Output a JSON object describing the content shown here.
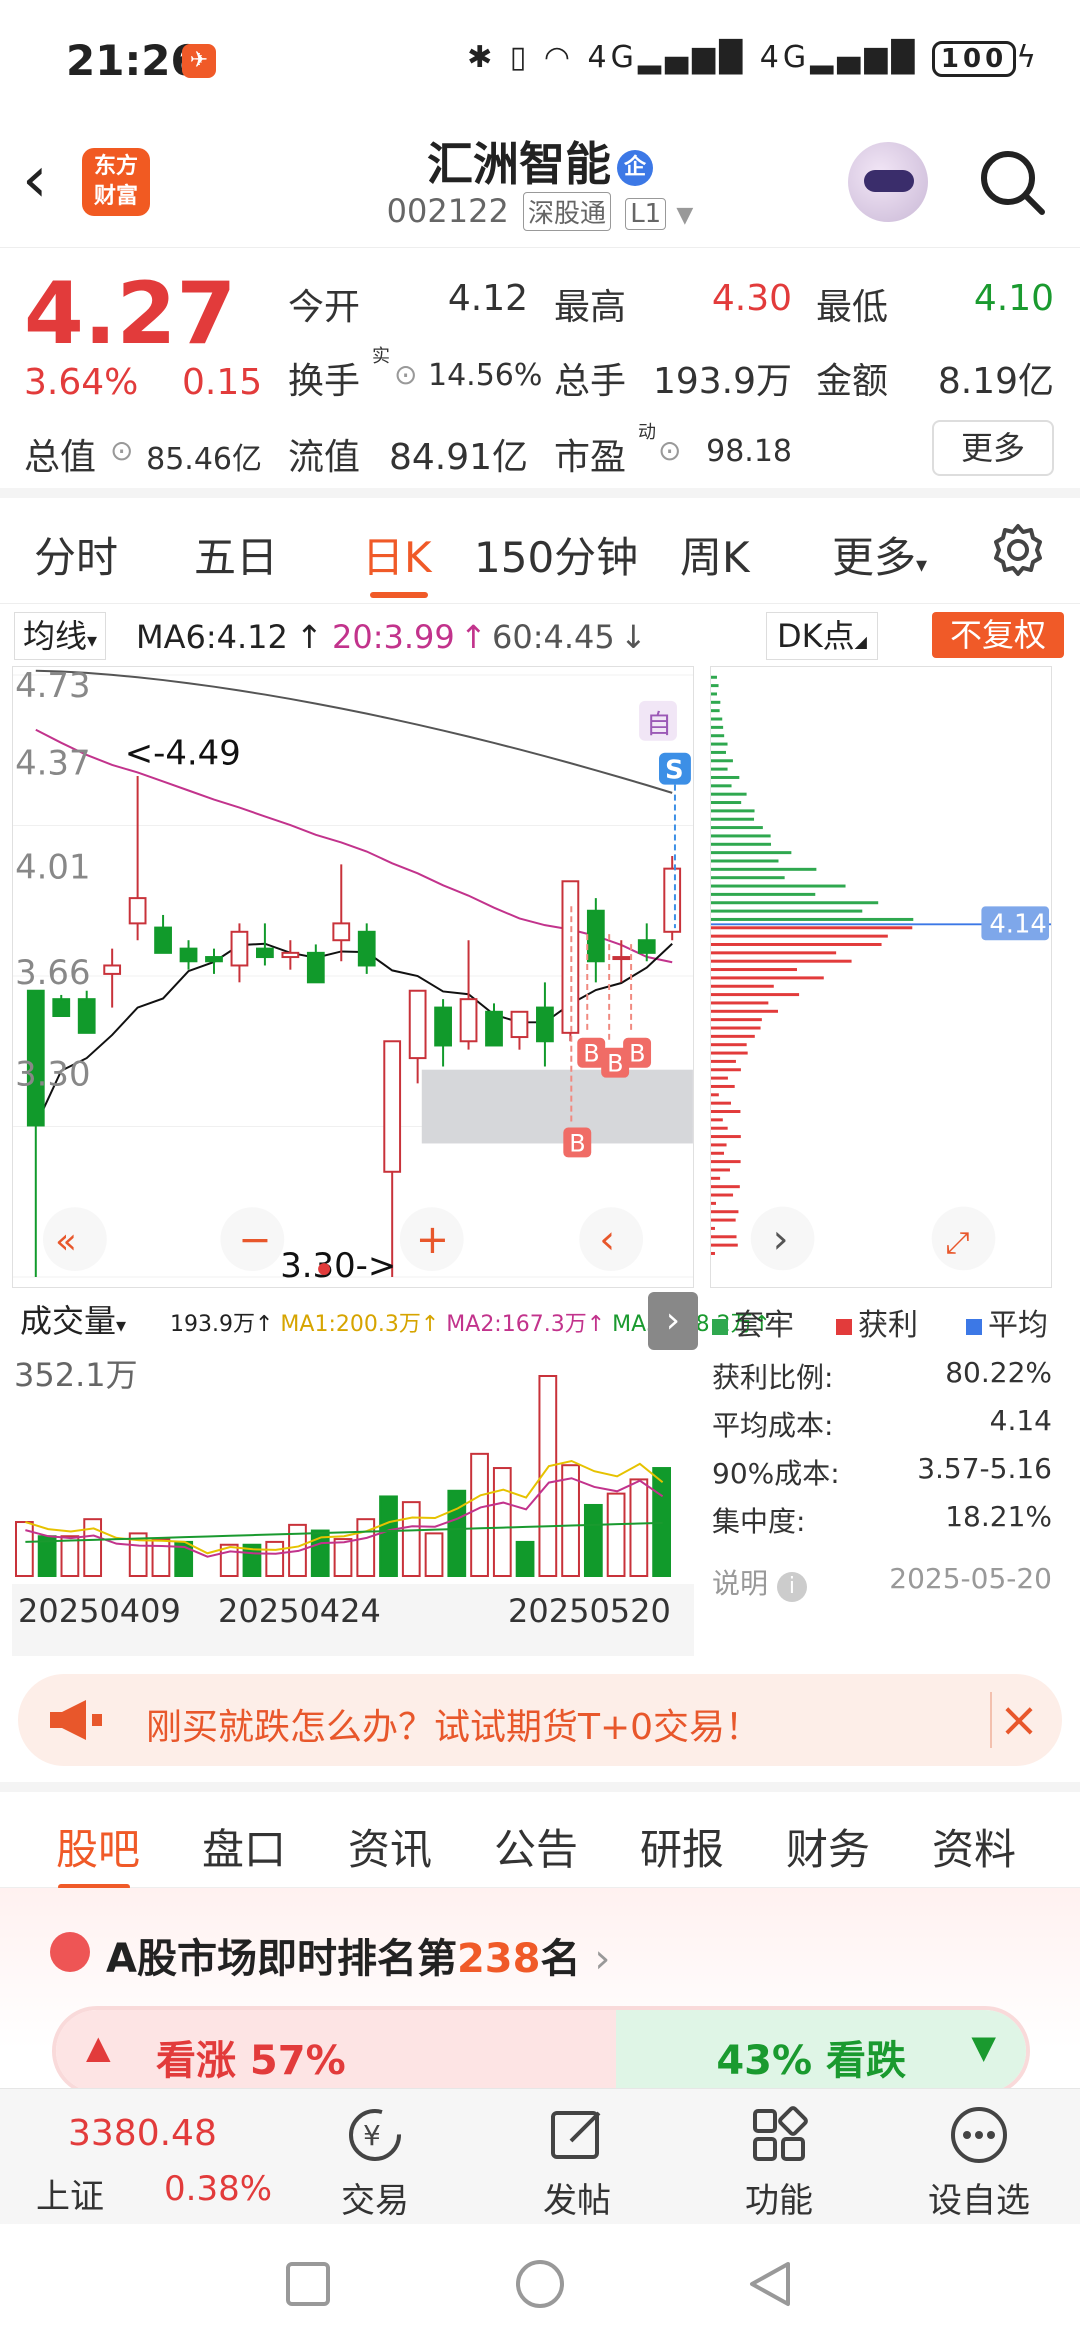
{
  "status_bar": {
    "time": "21:26",
    "network": "4G",
    "battery": "100"
  },
  "header": {
    "logo_line1": "东方",
    "logo_line2": "财富",
    "stock_name": "汇洲智能",
    "name_badge": "企",
    "stock_code": "002122",
    "tag_hk": "深股通",
    "tag_level": "L1"
  },
  "quote": {
    "price": "4.27",
    "change_pct": "3.64%",
    "change_amt": "0.15",
    "open_label": "今开",
    "open": "4.12",
    "high_label": "最高",
    "high": "4.30",
    "low_label": "最低",
    "low": "4.10",
    "turnover_label": "换手",
    "turnover_sup": "实",
    "turnover": "14.56%",
    "volume_label": "总手",
    "volume": "193.9万",
    "amount_label": "金额",
    "amount": "8.19亿",
    "mktcap_label": "总值",
    "mktcap": "85.46亿",
    "float_label": "流值",
    "float": "84.91亿",
    "pe_label": "市盈",
    "pe_sup": "动",
    "pe": "98.18",
    "more_label": "更多"
  },
  "period_tabs": [
    "分时",
    "五日",
    "日K",
    "150分钟",
    "周K",
    "更多"
  ],
  "active_period": "日K",
  "ma_row": {
    "select_label": "均线",
    "ma6": "MA6:4.12",
    "ma20": "20:3.99",
    "ma60": "60:4.45",
    "dk_label": "DK点",
    "fq_label": "不复权"
  },
  "kchart": {
    "y_labels": [
      "4.73",
      "4.37",
      "4.01",
      "3.66",
      "3.30"
    ],
    "high_marker": "<-4.49",
    "low_marker": "3.30->",
    "auto_label": "自",
    "sell_label": "S",
    "buy_label": "B"
  },
  "chip": {
    "avg_cost_tag": "4.14",
    "legend": [
      {
        "label": "套牢",
        "color": "#2fa84f"
      },
      {
        "label": "获利",
        "color": "#e23b3b"
      },
      {
        "label": "平均",
        "color": "#3c78e6"
      }
    ],
    "stats": [
      {
        "label": "获利比例:",
        "value": "80.22%"
      },
      {
        "label": "平均成本:",
        "value": "4.14"
      },
      {
        "label": "90%成本:",
        "value": "3.57-5.16"
      },
      {
        "label": "集中度:",
        "value": "18.21%"
      }
    ],
    "note_label": "说明",
    "note_date": "2025-05-20"
  },
  "volume": {
    "select_label": "成交量",
    "current": "193.9万↑",
    "ma1": "MA1:200.3万↑",
    "ma2": "MA2:167.3万↑",
    "ma3": "MA3:118.2万↑",
    "max_label": "352.1万",
    "dates": [
      "20250409",
      "20250424",
      "20250520"
    ]
  },
  "banner": {
    "text": "刚买就跌怎么办？试试期货T+0交易！"
  },
  "section_tabs": [
    "股吧",
    "盘口",
    "资讯",
    "公告",
    "研报",
    "财务",
    "资料"
  ],
  "rank": {
    "prefix": "A股市场即时排名第",
    "number": "238",
    "suffix": "名"
  },
  "vote": {
    "up": "看涨 57%",
    "down": "43% 看跌"
  },
  "bottom_nav": {
    "index_value": "3380.48",
    "index_name": "上证",
    "index_pct": "0.38%",
    "items": [
      "交易",
      "发帖",
      "功能",
      "设自选"
    ]
  },
  "colors": {
    "accent": "#f05a28",
    "up": "#e23b3b",
    "down": "#1a9a2f"
  },
  "chart_data": {
    "type": "candlestick",
    "ohlc": [
      {
        "o": 3.98,
        "h": 3.98,
        "l": 3.3,
        "c": 3.66
      },
      {
        "o": 3.96,
        "h": 3.97,
        "l": 3.92,
        "c": 3.92
      },
      {
        "o": 3.96,
        "h": 3.98,
        "l": 3.88,
        "c": 3.88
      },
      {
        "o": 4.02,
        "h": 4.08,
        "l": 3.94,
        "c": 4.04
      },
      {
        "o": 4.14,
        "h": 4.49,
        "l": 4.1,
        "c": 4.2
      },
      {
        "o": 4.13,
        "h": 4.16,
        "l": 4.07,
        "c": 4.07
      },
      {
        "o": 4.08,
        "h": 4.1,
        "l": 4.03,
        "c": 4.05
      },
      {
        "o": 4.06,
        "h": 4.08,
        "l": 4.02,
        "c": 4.05
      },
      {
        "o": 4.04,
        "h": 4.14,
        "l": 4.0,
        "c": 4.12
      },
      {
        "o": 4.08,
        "h": 4.14,
        "l": 4.04,
        "c": 4.06
      },
      {
        "o": 4.06,
        "h": 4.1,
        "l": 4.03,
        "c": 4.07
      },
      {
        "o": 4.07,
        "h": 4.09,
        "l": 4.0,
        "c": 4.0
      },
      {
        "o": 4.1,
        "h": 4.28,
        "l": 4.05,
        "c": 4.14
      },
      {
        "o": 4.12,
        "h": 4.14,
        "l": 4.02,
        "c": 4.04
      },
      {
        "o": 3.55,
        "h": 3.55,
        "l": 3.3,
        "c": 3.86
      },
      {
        "o": 3.82,
        "h": 3.9,
        "l": 3.76,
        "c": 3.98
      },
      {
        "o": 3.94,
        "h": 3.96,
        "l": 3.8,
        "c": 3.85
      },
      {
        "o": 3.86,
        "h": 4.1,
        "l": 3.84,
        "c": 3.96
      },
      {
        "o": 3.93,
        "h": 3.95,
        "l": 3.85,
        "c": 3.85
      },
      {
        "o": 3.87,
        "h": 3.93,
        "l": 3.84,
        "c": 3.93
      },
      {
        "o": 3.94,
        "h": 4.0,
        "l": 3.8,
        "c": 3.86
      },
      {
        "o": 3.88,
        "h": 4.24,
        "l": 3.86,
        "c": 4.24
      },
      {
        "o": 4.17,
        "h": 4.2,
        "l": 4.0,
        "c": 4.05
      },
      {
        "o": 4.06,
        "h": 4.1,
        "l": 4.0,
        "c": 4.06
      },
      {
        "o": 4.1,
        "h": 4.14,
        "l": 4.05,
        "c": 4.07
      },
      {
        "o": 4.12,
        "h": 4.3,
        "l": 4.1,
        "c": 4.27
      }
    ],
    "volume": [
      95,
      70,
      70,
      100,
      0,
      75,
      65,
      60,
      0,
      55,
      55,
      60,
      90,
      80,
      65,
      100,
      140,
      130,
      75,
      150,
      215,
      190,
      60,
      352,
      195,
      125,
      145,
      170,
      190
    ],
    "y_range": [
      3.3,
      4.73
    ],
    "volume_max": "352.1万"
  }
}
